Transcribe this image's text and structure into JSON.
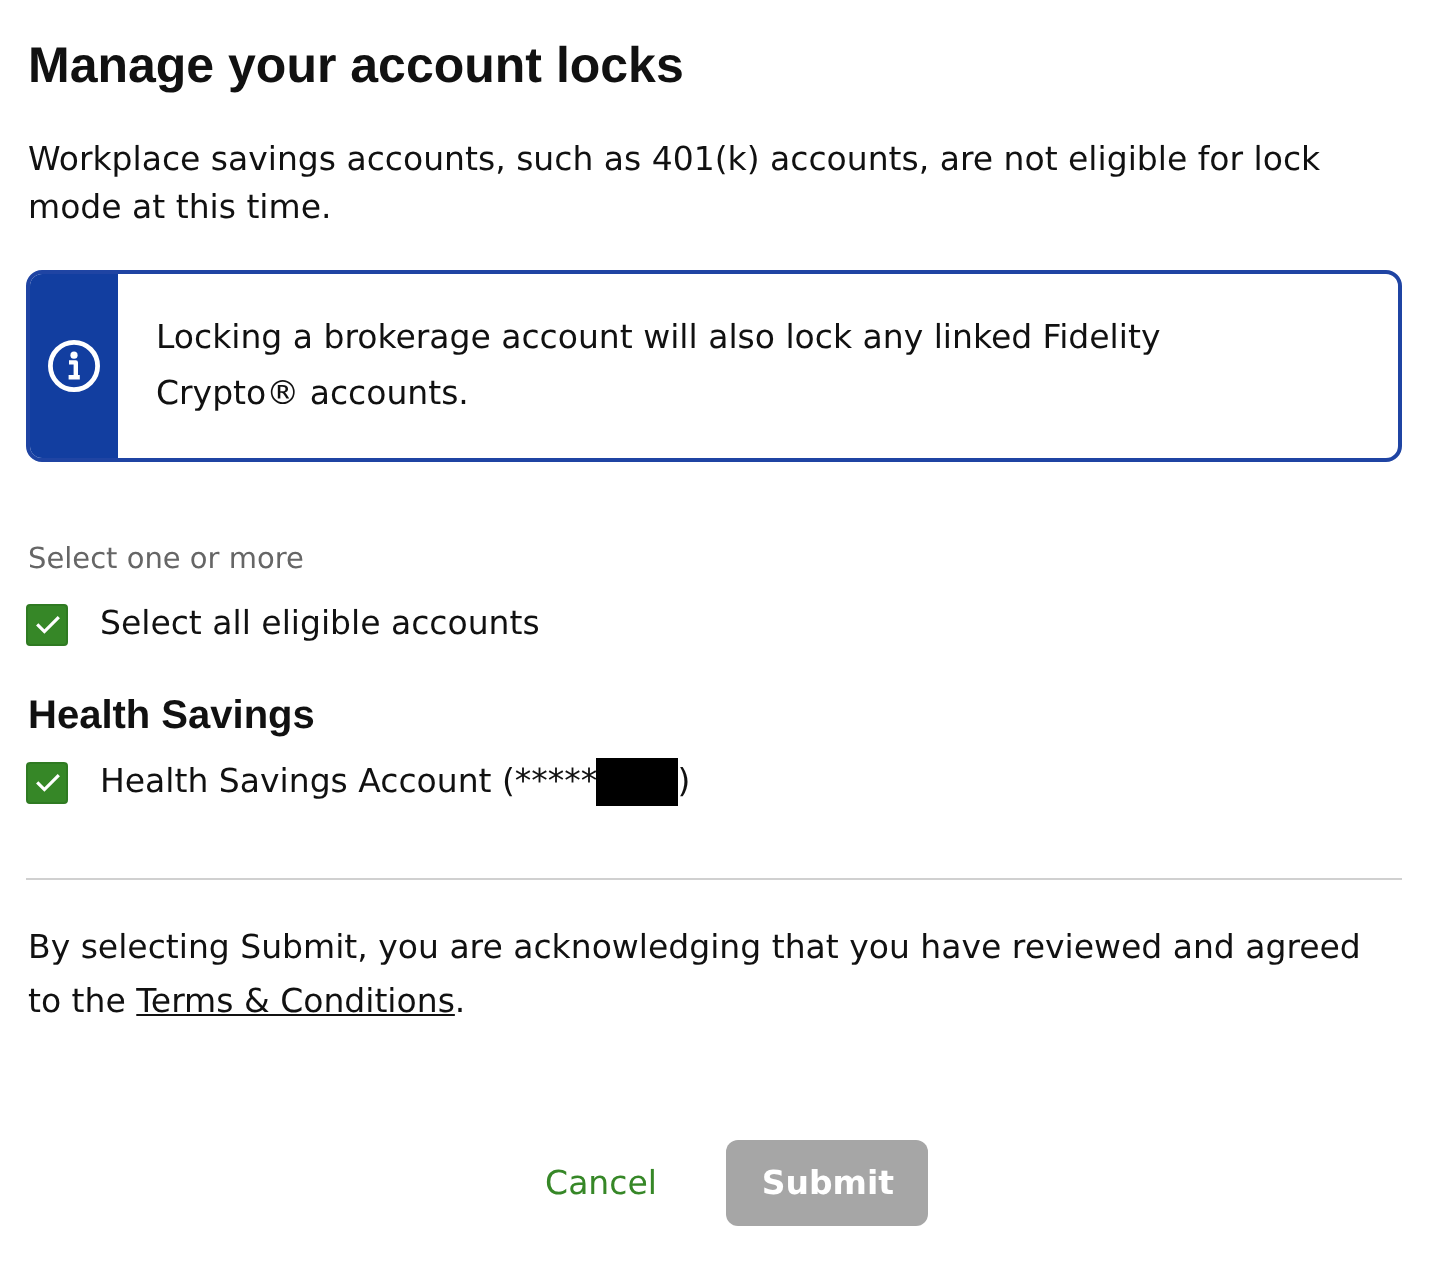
{
  "title": "Manage your account locks",
  "notice": "Workplace savings accounts, such as 401(k) accounts, are not eligible for lock mode at this time.",
  "alert": {
    "kind": "info",
    "text": "Locking a brokerage account will also lock any linked Fidelity Crypto® accounts."
  },
  "select_hint": "Select one or more",
  "select_all": {
    "label": "Select all eligible accounts",
    "checked": true
  },
  "groups": [
    {
      "heading": "Health Savings",
      "accounts": [
        {
          "label": "Health Savings Account (*****",
          "redacted": true,
          "label_end": ")",
          "checked": true
        }
      ]
    }
  ],
  "disclaimer": {
    "text": "By selecting Submit, you are acknowledging that you have reviewed and agreed to the",
    "link": "Terms & Conditions",
    "end": "."
  },
  "buttons": [
    {
      "kind": "link",
      "label": "Cancel",
      "disabled": false
    },
    {
      "kind": "primary",
      "label": "Submit",
      "disabled": true
    }
  ]
}
